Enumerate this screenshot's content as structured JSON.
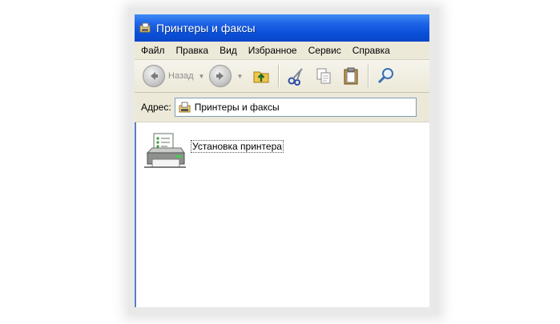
{
  "window": {
    "title": "Принтеры и факсы"
  },
  "menu": {
    "items": [
      "Файл",
      "Правка",
      "Вид",
      "Избранное",
      "Сервис",
      "Справка"
    ]
  },
  "toolbar": {
    "back_label": "Назад",
    "icons": [
      "back-arrow-icon",
      "forward-arrow-icon",
      "folder-up-icon",
      "cut-icon",
      "copy-icon",
      "paste-icon",
      "search-icon"
    ]
  },
  "address": {
    "label": "Адрес:",
    "value": "Принтеры и факсы"
  },
  "content": {
    "items": [
      {
        "label": "Установка принтера",
        "icon": "add-printer-icon"
      }
    ]
  },
  "colors": {
    "titlebar": "#0a4fd8",
    "chrome": "#ece9d8",
    "address_border": "#7f9db9"
  }
}
